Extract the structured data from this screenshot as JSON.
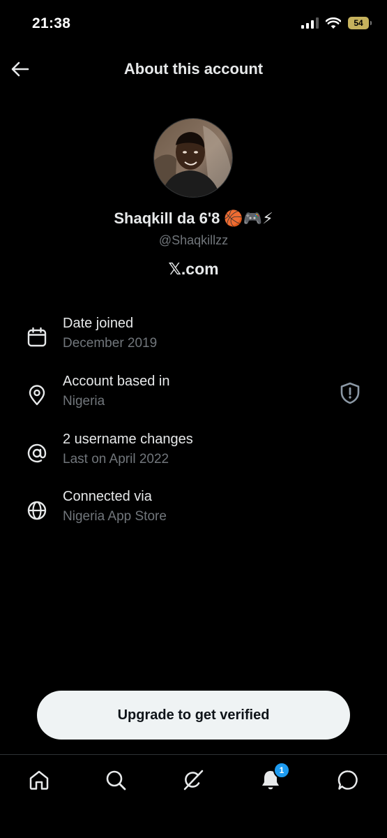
{
  "status_bar": {
    "time": "21:38",
    "battery": "54",
    "icons": [
      "cellular-signal-icon",
      "wifi-icon",
      "battery-icon"
    ],
    "battery_color": "#c6b25d"
  },
  "header": {
    "title": "About this account",
    "back_icon": "arrow-left-icon"
  },
  "profile": {
    "display_name": "Shaqkill da 6'8 🏀🎮⚡",
    "handle": "@Shaqkillzz",
    "site": "𝕏.com"
  },
  "info": [
    {
      "icon": "calendar-icon",
      "label": "Date joined",
      "value": "December 2019"
    },
    {
      "icon": "location-pin-icon",
      "label": "Account based in",
      "value": "Nigeria",
      "trailing_icon": "shield-icon"
    },
    {
      "icon": "at-icon",
      "label": "2 username changes",
      "value": "Last on April 2022"
    },
    {
      "icon": "globe-icon",
      "label": "Connected via",
      "value": "Nigeria App Store"
    }
  ],
  "upgrade_button": {
    "label": "Upgrade to get verified"
  },
  "tab_bar": {
    "tabs": [
      "home-icon",
      "search-icon",
      "grok-icon",
      "notifications-icon",
      "messages-icon"
    ],
    "notification_count": "1",
    "badge_color": "#1d9bf0"
  },
  "colors": {
    "background": "#000000",
    "primary_text": "#e7e9ea",
    "secondary_text": "#71767b",
    "button_bg": "#eff3f4"
  }
}
